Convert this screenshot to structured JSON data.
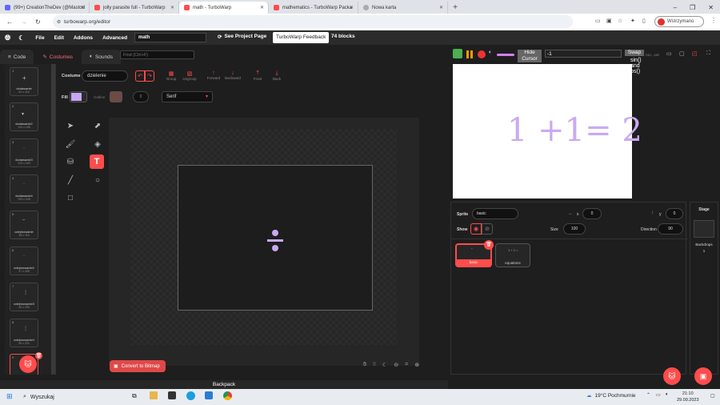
{
  "browser": {
    "tabs": [
      {
        "label": "(99+) CreationTheDev (@Mastod"
      },
      {
        "label": "jolly parasite full - TurboWarp"
      },
      {
        "label": "math - TurboWarp"
      },
      {
        "label": "mathematics - TurboWarp Packa"
      },
      {
        "label": "Nowa karta"
      }
    ],
    "url": "turbowarp.org/editor",
    "profile_label": "Wstrzymano"
  },
  "menu": {
    "file": "File",
    "edit": "Edit",
    "addons": "Addons",
    "advanced": "Advanced",
    "project_title": "math",
    "see_project_page": "See Project Page",
    "feedback": "TurboWarp Feedback",
    "blocks": "74 blocks"
  },
  "editor_tabs": {
    "code": "Code",
    "costumes": "Costumes",
    "sounds": "Sounds"
  },
  "find_placeholder": "Find (Ctrl+F)",
  "costumes": [
    {
      "num": "1",
      "name": "dodawanie",
      "size": "62 x 118"
    },
    {
      "num": "2",
      "name": "dodawanie2",
      "size": "124 x 168"
    },
    {
      "num": "3",
      "name": "dodawanie3",
      "size": "213 x 183"
    },
    {
      "num": "4",
      "name": "dodawanie4",
      "size": "293 x 208"
    },
    {
      "num": "5",
      "name": "odejmowanie",
      "size": "38 x 116"
    },
    {
      "num": "6",
      "name": "odejmowanie2",
      "size": "47 x 428"
    },
    {
      "num": "7",
      "name": "odejmowanie3",
      "size": "46 x 253"
    },
    {
      "num": "8",
      "name": "odejmowanie4",
      "size": "46 x 232"
    },
    {
      "num": "9",
      "name": "",
      "size": ""
    }
  ],
  "paint": {
    "costume_label": "Costume",
    "costume_name": "dzielenie",
    "group": "Group",
    "ungroup": "Ungroup",
    "forward": "Forward",
    "backward": "Backward",
    "front": "Front",
    "back": "Back",
    "fill_label": "Fill",
    "outline_label": "Outline",
    "outline_value": "0",
    "font": "Serif",
    "convert": "Convert to Bitmap",
    "zoom_eq": "="
  },
  "stage": {
    "hide_cursor": "Hide Cursor",
    "input_value": "-1",
    "swap": "Swap",
    "swap_lines": [
      "sin()",
      "and",
      "os()"
    ],
    "res": "240, -180",
    "equation": "1 +1= 2"
  },
  "sprite": {
    "sprite_label": "Sprite",
    "sprite_name": "basic",
    "x_label": "x",
    "x": "0",
    "y_label": "y",
    "y": "0",
    "show_label": "Show",
    "size_label": "Size",
    "size": "100",
    "direction_label": "Direction",
    "direction": "90",
    "sprites": [
      {
        "name": "basic",
        "thumb": "-"
      },
      {
        "name": "equations",
        "thumb": "1 + 1 ="
      }
    ]
  },
  "stage_panel": {
    "title": "Stage",
    "backdrops_label": "Backdrops",
    "backdrops_count": "1"
  },
  "backpack": "Backpack",
  "taskbar": {
    "search": "Wyszukaj",
    "weather": "19°C  Pochmurnie",
    "time": "21:10",
    "date": "29.09.2023"
  },
  "colors": {
    "accent": "#ff4c4c",
    "fill": "#c8a6f5",
    "purple_glyph": "#c9a9f3"
  }
}
